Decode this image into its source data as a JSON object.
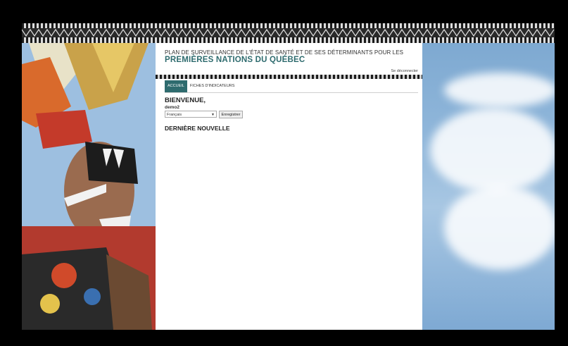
{
  "header": {
    "subtitle": "PLAN DE SURVEILLANCE DE L'ÉTAT DE SANTÉ ET DE SES DÉTERMINANTS POUR LES",
    "title": "PREMIÈRES NATIONS DU QUÉBEC",
    "logout_label": "Se déconnecter"
  },
  "tabs": [
    {
      "label": "ACCUEIL",
      "active": true
    },
    {
      "label": "FICHES D'INDICATEURS",
      "active": false
    }
  ],
  "main": {
    "welcome": "BIENVENUE,",
    "username": "demo2",
    "language_selected": "Français",
    "save_label": "Enregistrer",
    "news_heading": "DERNIÈRE NOUVELLE"
  },
  "colors": {
    "accent": "#2e6b6e",
    "sky": "#8fb6da"
  }
}
